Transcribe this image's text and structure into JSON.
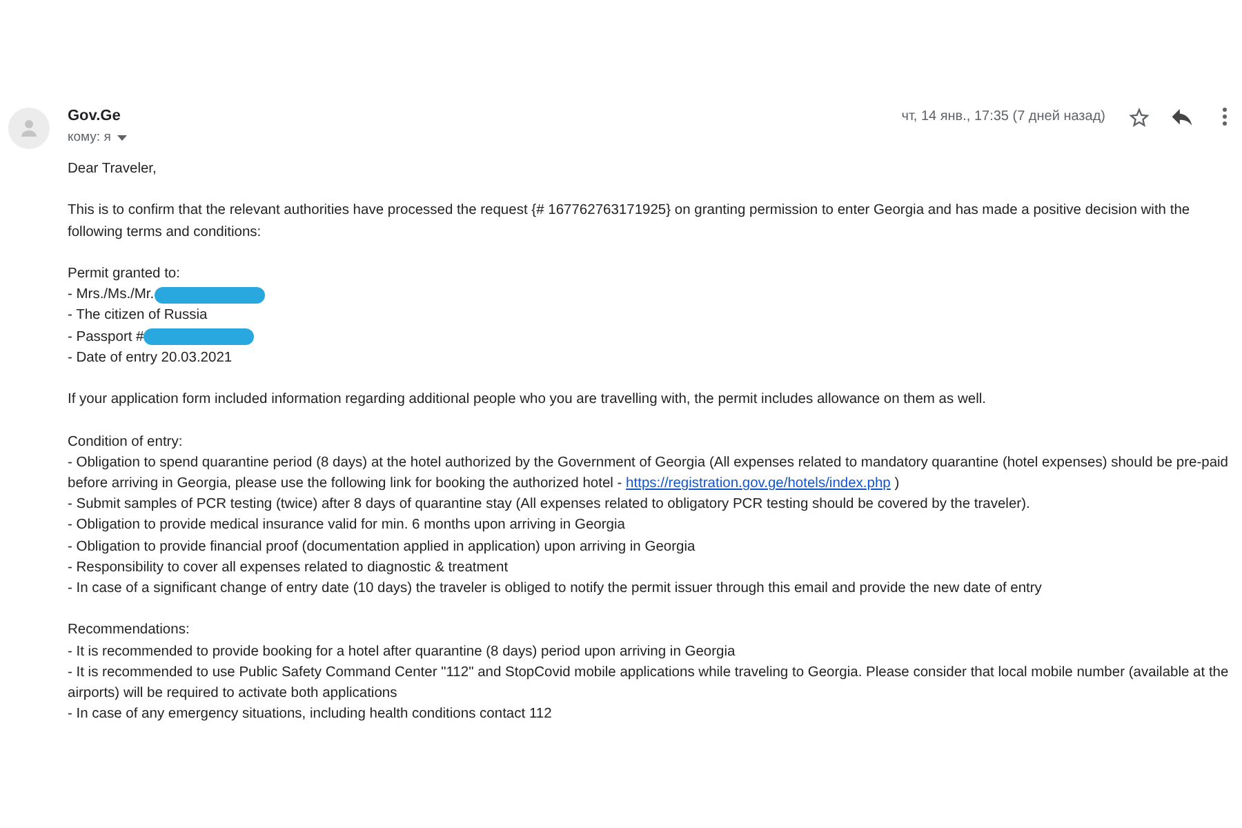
{
  "message": {
    "sender": "Gov.Ge",
    "recipient": "кому: я",
    "date": "чт, 14 янв., 17:35 (7 дней назад)",
    "starred": false
  },
  "body": [
    {
      "lines": [
        {
          "text": "Dear Traveler,"
        }
      ]
    },
    {
      "lines": [
        {
          "text": "This is to confirm that the relevant authorities have processed the request {# 167762763171925} on granting permission to enter Georgia and has made a positive decision with the following terms and conditions:"
        }
      ]
    },
    {
      "lines": [
        {
          "text": "Permit granted to:"
        },
        {
          "text": "- Mrs./Ms./Mr.",
          "redacted": true
        },
        {
          "text": "- The citizen of Russia"
        },
        {
          "text": "- Passport #",
          "redacted": true
        },
        {
          "text": "- Date of entry 20.03.2021"
        }
      ]
    },
    {
      "lines": [
        {
          "text": "If your application form included information regarding additional people who you are travelling with, the permit includes allowance on them as well."
        }
      ]
    },
    {
      "lines": [
        {
          "text": "Condition of entry:"
        },
        {
          "text": "- Obligation to spend quarantine period (8 days) at the hotel authorized by the Government of Georgia (All expenses related to mandatory quarantine (hotel expenses) should be pre-paid before arriving in Georgia, please use the following link for booking the authorized hotel - ",
          "link": "https://registration.gov.ge/hotels/index.php",
          "text_after": " )"
        },
        {
          "text": "- Submit samples of PCR testing (twice) after 8 days of quarantine stay (All expenses related to obligatory PCR testing should be covered by the traveler)."
        },
        {
          "text": "- Obligation to provide medical insurance valid for min. 6 months upon arriving in Georgia"
        },
        {
          "text": "- Obligation to provide financial proof (documentation applied in application) upon arriving in Georgia"
        },
        {
          "text": "- Responsibility to cover all expenses related to diagnostic & treatment"
        },
        {
          "text": "- In case of a significant change of entry date (10 days) the traveler is obliged to notify the permit issuer through this email and provide the new date of entry"
        }
      ]
    },
    {
      "lines": [
        {
          "text": "Recommendations:"
        },
        {
          "text": "- It is recommended to provide booking for a hotel after quarantine (8 days) period upon arriving in Georgia"
        },
        {
          "text": "- It is recommended to use Public Safety Command Center \"112\" and StopCovid mobile applications while traveling to Georgia. Please consider that local mobile number (available at the airports) will be required to activate both applications"
        },
        {
          "text": "- In case of any emergency situations, including health conditions contact 112"
        }
      ]
    }
  ]
}
